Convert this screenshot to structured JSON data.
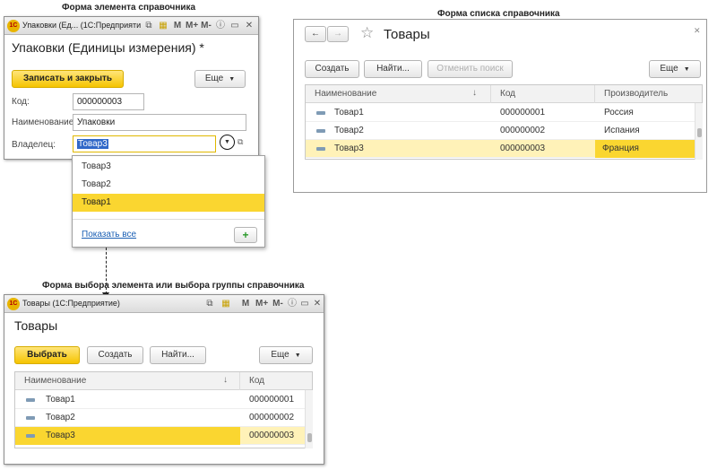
{
  "captions": {
    "element_form": "Форма элемента справочника",
    "list_form": "Форма списка справочника",
    "choice_form": "Форма выбора элемента или выбора группы справочника"
  },
  "element_window": {
    "window_title": "Упаковки (Ед... (1С:Предприятие)",
    "form_title": "Упаковки (Единицы измерения) *",
    "save_close_label": "Записать и закрыть",
    "more_label": "Еще",
    "code_label": "Код:",
    "code_value": "000000003",
    "name_label": "Наименование:",
    "name_value": "Упаковки",
    "owner_label": "Владелец:",
    "owner_value": "Товар3"
  },
  "dropdown": {
    "items": [
      "Товар3",
      "Товар2",
      "Товар1"
    ],
    "highlighted_index": 2,
    "show_all_label": "Показать все",
    "add_label": "+"
  },
  "list_window": {
    "form_title": "Товары",
    "create_label": "Создать",
    "find_label": "Найти...",
    "cancel_search_label": "Отменить поиск",
    "more_label": "Еще",
    "columns": [
      "Наименование",
      "Код",
      "Производитель"
    ],
    "rows": [
      {
        "name": "Товар1",
        "code": "000000001",
        "maker": "Россия"
      },
      {
        "name": "Товар2",
        "code": "000000002",
        "maker": "Испания"
      },
      {
        "name": "Товар3",
        "code": "000000003",
        "maker": "Франция"
      }
    ],
    "selected_index": 2
  },
  "choice_window": {
    "window_title": "Товары (1С:Предприятие)",
    "form_title": "Товары",
    "select_label": "Выбрать",
    "create_label": "Создать",
    "find_label": "Найти...",
    "more_label": "Еще",
    "columns": [
      "Наименование",
      "Код"
    ],
    "rows": [
      {
        "name": "Товар1",
        "code": "000000001"
      },
      {
        "name": "Товар2",
        "code": "000000002"
      },
      {
        "name": "Товар3",
        "code": "000000003"
      }
    ],
    "selected_index": 2
  },
  "icons": {
    "logo": "1c-logo-icon",
    "back": "arrow-left-icon",
    "forward": "arrow-right-icon",
    "favorite": "star-icon",
    "close": "close-icon",
    "open": "open-link-icon",
    "sort": "sort-down-icon",
    "item": "catalog-item-icon"
  },
  "colors": {
    "accent": "#f5c400",
    "highlight": "#fad630",
    "selected_row": "#fff2b8",
    "link": "#1a5fb4"
  }
}
